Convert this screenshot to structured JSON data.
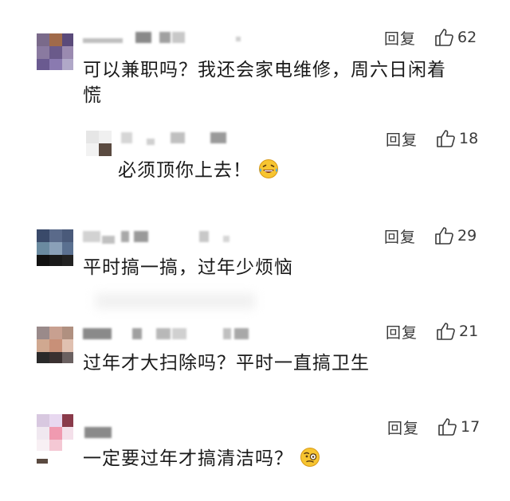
{
  "comments": [
    {
      "reply": "回复",
      "likes": "62",
      "text_lines": [
        "可以兼职吗？我还会家电维修，周六日闲着",
        "慌"
      ]
    },
    {
      "reply": "回复",
      "likes": "18",
      "text": "必须顶你上去！",
      "emoji": "laughing-tears"
    },
    {
      "reply": "回复",
      "likes": "29",
      "text": "平时搞一搞，过年少烦恼"
    },
    {
      "reply": "回复",
      "likes": "21",
      "text": "过年才大扫除吗？平时一直搞卫生"
    },
    {
      "reply": "回复",
      "likes": "17",
      "text": "一定要过年才搞清洁吗？",
      "emoji": "skeptical-face"
    }
  ],
  "colors": {
    "text": "#1a1a1a",
    "secondary": "#3a3a3a",
    "blur": "#bfbfbf"
  }
}
